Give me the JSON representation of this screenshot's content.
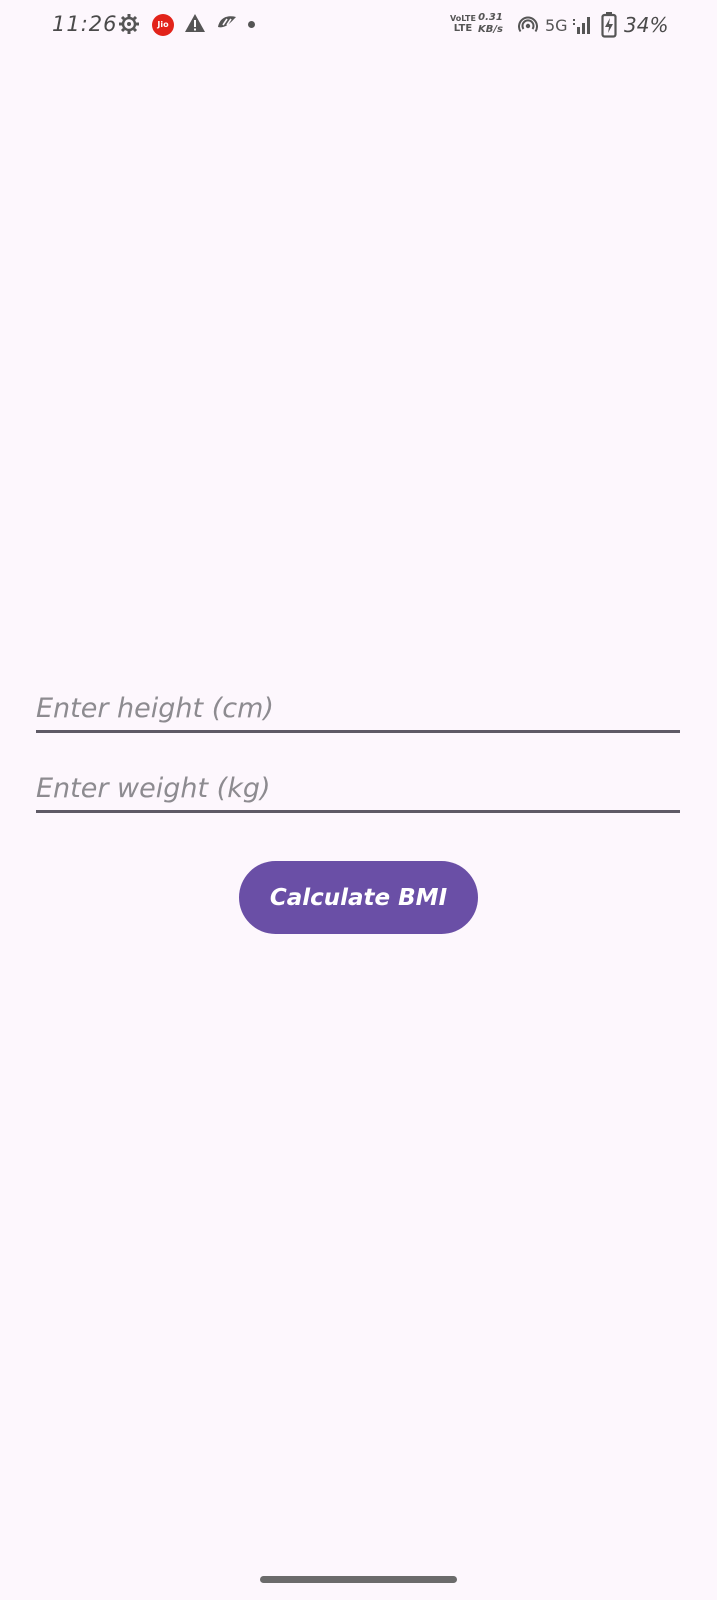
{
  "status_bar": {
    "time": "11:26",
    "jio_label": "Jio",
    "volte_top": "VoLTE",
    "volte_bottom": "LTE",
    "speed_value": "0.31",
    "speed_unit": "KB/s",
    "network": "5G",
    "battery_percent": "34%",
    "icons": [
      "gear-icon",
      "jio-icon",
      "warning-icon",
      "app-notification-icon",
      "dot-icon",
      "hotspot-icon",
      "signal-icon",
      "battery-icon"
    ]
  },
  "form": {
    "height_placeholder": "Enter height (cm)",
    "height_value": "",
    "weight_placeholder": "Enter weight (kg)",
    "weight_value": ""
  },
  "actions": {
    "calculate_label": "Calculate BMI"
  },
  "colors": {
    "background": "#FDF7FD",
    "button": "#6A4FA6",
    "underline": "#5F5A66"
  }
}
